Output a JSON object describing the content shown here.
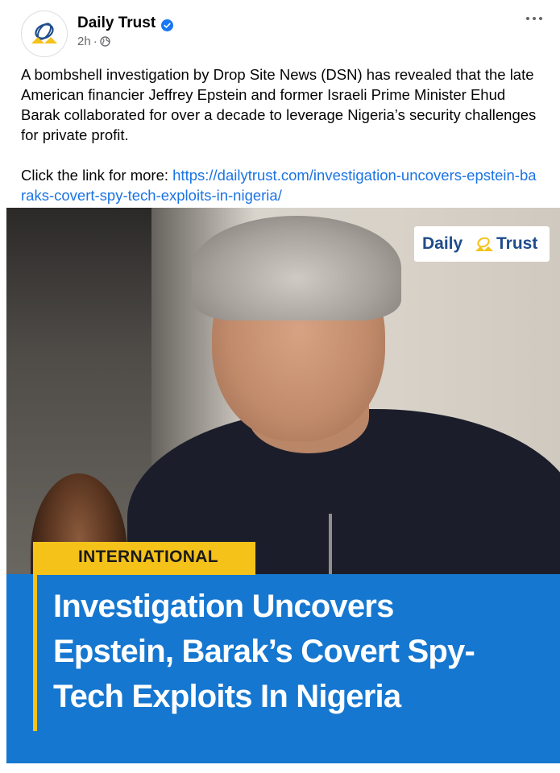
{
  "post": {
    "page_name": "Daily Trust",
    "time": "2h",
    "separator": "·",
    "audience_icon": "globe-icon",
    "verified_icon": "verified-badge-icon",
    "more_icon": "more-options-icon",
    "text_paragraph_1": "A bombshell investigation by Drop Site News (DSN) has revealed that the late American financier Jeffrey Epstein and former Israeli Prime Minister Ehud Barak collaborated for over a decade to leverage Nigeria’s security challenges for private profit.",
    "text_link_prefix": "Click the link for more: ",
    "link_url": "https://dailytrust.com/investigation-uncovers-epstein-baraks-covert-spy-tech-exploits-in-nigeria/"
  },
  "media": {
    "brand_daily": "Daily",
    "brand_trust": "Trust",
    "category_tag": "INTERNATIONAL",
    "headline_lines": [
      "Investigation Uncovers",
      "Epstein, Barak’s Covert Spy-",
      "Tech Exploits In Nigeria"
    ]
  },
  "colors": {
    "link": "#1b74e4",
    "verified": "#1877f2",
    "panel_blue": "#1577d0",
    "tag_yellow": "#f5c21a"
  }
}
